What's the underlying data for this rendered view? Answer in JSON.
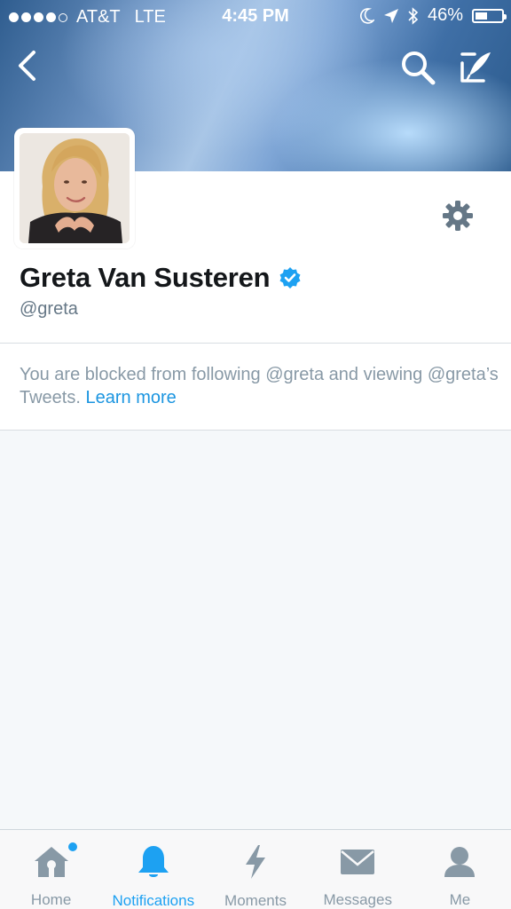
{
  "status_bar": {
    "carrier": "AT&T",
    "network": "LTE",
    "time": "4:45 PM",
    "battery_percent": "46%",
    "battery_level": 0.46
  },
  "profile": {
    "display_name": "Greta Van Susteren",
    "handle": "@greta",
    "verified": true
  },
  "blocked_notice": {
    "message": "You are blocked from following @greta and viewing @greta’s Tweets.",
    "link_label": "Learn more"
  },
  "tabs": [
    {
      "label": "Home",
      "icon": "home-icon",
      "active": false,
      "has_dot": true
    },
    {
      "label": "Notifications",
      "icon": "bell-icon",
      "active": true,
      "has_dot": false
    },
    {
      "label": "Moments",
      "icon": "lightning-icon",
      "active": false,
      "has_dot": false
    },
    {
      "label": "Messages",
      "icon": "envelope-icon",
      "active": false,
      "has_dot": false
    },
    {
      "label": "Me",
      "icon": "person-icon",
      "active": false,
      "has_dot": false
    }
  ],
  "colors": {
    "accent": "#1da1f2",
    "link": "#1b95e0",
    "muted_text": "#8899a6",
    "icon_gray": "#657786",
    "verified_badge": "#1da1f2"
  }
}
